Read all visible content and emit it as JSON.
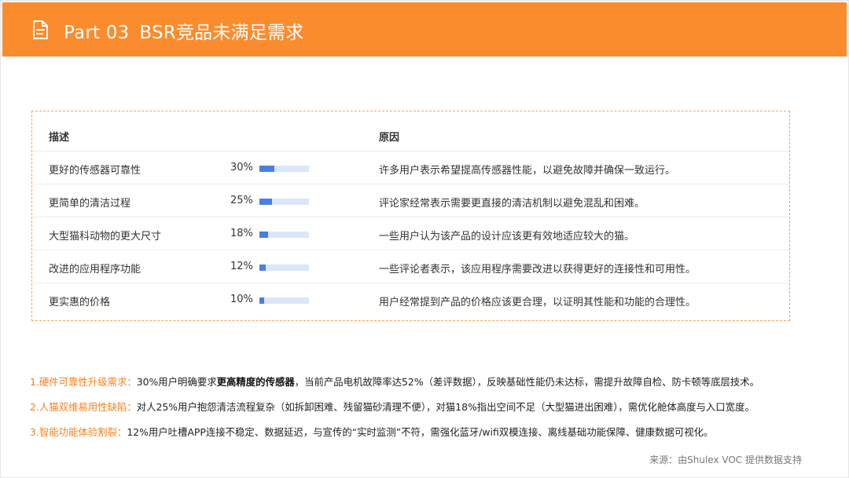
{
  "header": {
    "part": "Part 03",
    "title": "BSR竞品未满足需求",
    "background_color": "#fb8c2e"
  },
  "table": {
    "columns": {
      "description": "描述",
      "reason": "原因"
    },
    "rows": [
      {
        "description": "更好的传感器可靠性",
        "percent_label": "30%",
        "percent": 30,
        "reason": "许多用户表示希望提高传感器性能，以避免故障并确保一致运行。"
      },
      {
        "description": "更简单的清洁过程",
        "percent_label": "25%",
        "percent": 25,
        "reason": "评论家经常表示需要更直接的清洁机制以避免混乱和困难。"
      },
      {
        "description": "大型猫科动物的更大尺寸",
        "percent_label": "18%",
        "percent": 18,
        "reason": "一些用户认为该产品的设计应该更有效地适应较大的猫。"
      },
      {
        "description": "改进的应用程序功能",
        "percent_label": "12%",
        "percent": 12,
        "reason": "一些评论者表示，该应用程序需要改进以获得更好的连接性和可用性。"
      },
      {
        "description": "更实惠的价格",
        "percent_label": "10%",
        "percent": 10,
        "reason": "用户经常提到产品的价格应该更合理，以证明其性能和功能的合理性。"
      }
    ],
    "bar_color": "#4a7fe0",
    "bar_track_color": "#dbe6fa",
    "border_color": "#f3a15f"
  },
  "notes": [
    {
      "label": "1.硬件可靠性升级需求：",
      "text_before": "30%用户明确要求",
      "bold": "更高精度的传感器",
      "text_after": "，当前产品电机故障率达52%（差评数据），反映基础性能仍未达标，需提升故障自检、防卡顿等底层技术。"
    },
    {
      "label": "2.人猫双维易用性缺陷：",
      "text_before": "对人25%用户抱怨清洁流程复杂（如拆卸困难、残留猫砂清理不便），对猫18%指出空间不足（大型猫进出困难），需优化舱体高度与入口宽度。",
      "bold": "",
      "text_after": ""
    },
    {
      "label": "3.智能功能体验割裂：",
      "text_before": "12%用户吐槽APP连接不稳定、数据延迟，与宣传的“实时监测”不符，需强化蓝牙/wifi双模连接、离线基础功能保障、健康数据可视化。",
      "bold": "",
      "text_after": ""
    }
  ],
  "note_label_color": "#f5821f",
  "source": "来源：由Shulex VOC 提供数据支持",
  "icons": {
    "header": "document-icon"
  }
}
